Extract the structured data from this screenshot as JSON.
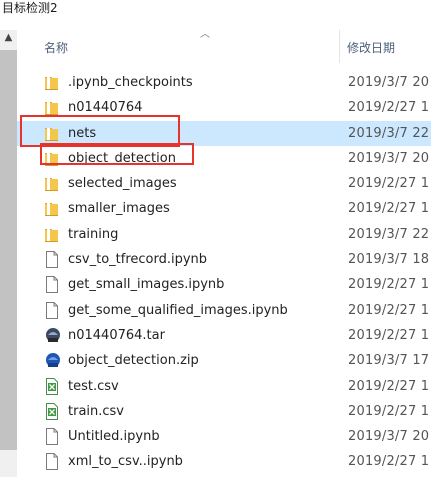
{
  "window": {
    "title": "目标检测2"
  },
  "columns": {
    "name": "名称",
    "date": "修改日期"
  },
  "colors": {
    "selected": "#cce8ff",
    "highlight": "#e8322c",
    "folder": "#f5c64c"
  },
  "files": [
    {
      "name": ".ipynb_checkpoints",
      "date": "2019/3/7 20",
      "icon": "folder-icon",
      "selected": false
    },
    {
      "name": "n01440764",
      "date": "2019/2/27 1",
      "icon": "folder-icon",
      "selected": false
    },
    {
      "name": "nets",
      "date": "2019/3/7 22",
      "icon": "folder-icon",
      "selected": true
    },
    {
      "name": "object_detection",
      "date": "2019/3/7 20",
      "icon": "folder-icon",
      "selected": false
    },
    {
      "name": "selected_images",
      "date": "2019/2/27 1",
      "icon": "folder-icon",
      "selected": false
    },
    {
      "name": "smaller_images",
      "date": "2019/2/27 1",
      "icon": "folder-icon",
      "selected": false
    },
    {
      "name": "training",
      "date": "2019/3/7 22",
      "icon": "folder-icon",
      "selected": false
    },
    {
      "name": "csv_to_tfrecord.ipynb",
      "date": "2019/3/7 18",
      "icon": "document-icon",
      "selected": false
    },
    {
      "name": "get_small_images.ipynb",
      "date": "2019/2/27 1",
      "icon": "document-icon",
      "selected": false
    },
    {
      "name": "get_some_qualified_images.ipynb",
      "date": "2019/2/27 1",
      "icon": "document-icon",
      "selected": false
    },
    {
      "name": "n01440764.tar",
      "date": "2019/2/27 1",
      "icon": "tar-archive-icon",
      "selected": false
    },
    {
      "name": "object_detection.zip",
      "date": "2019/3/7 17",
      "icon": "zip-archive-icon",
      "selected": false
    },
    {
      "name": "test.csv",
      "date": "2019/2/27 1",
      "icon": "csv-spreadsheet-icon",
      "selected": false
    },
    {
      "name": "train.csv",
      "date": "2019/2/27 1",
      "icon": "csv-spreadsheet-icon",
      "selected": false
    },
    {
      "name": "Untitled.ipynb",
      "date": "2019/3/7 20",
      "icon": "document-icon",
      "selected": false
    },
    {
      "name": "xml_to_csv..ipynb",
      "date": "2019/2/27 1",
      "icon": "document-icon",
      "selected": false
    }
  ],
  "annotations": [
    {
      "target": "nets"
    },
    {
      "target": "object_detection"
    }
  ]
}
